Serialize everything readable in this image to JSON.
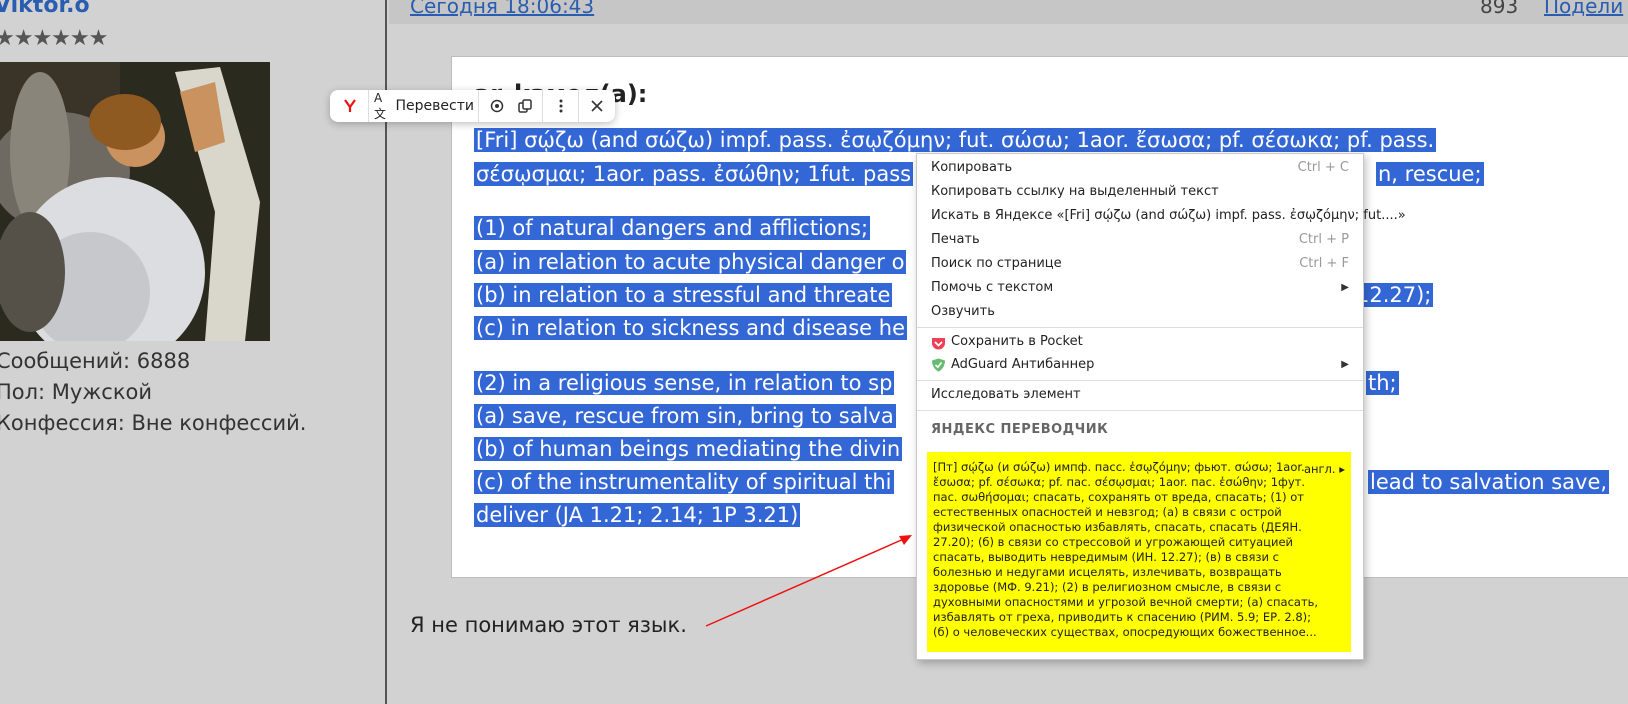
{
  "user": {
    "name": "Viktor.o",
    "stars": "★★★★★★",
    "messages": "Сообщений: 6888",
    "gender": "Пол: Мужской",
    "confession": "Конфессия: Вне конфессий."
  },
  "post": {
    "date": "Сегодня 18:06:43",
    "number": "893",
    "share": "Подели"
  },
  "quote": {
    "author": "ar_kaмeл(a):",
    "lines": [
      "[Fri] σῴζω (and σώζω) impf. pass. ἐσῳζόμην; fut. σώσω; 1aor. ἔσωσα; pf. σέσωκα; pf. pass.",
      "σέσῳσμαι; 1aor. pass. ἐσώθην; 1fut. pass",
      "(1) of natural dangers and afflictions;",
      "(a) in relation to acute physical danger o",
      "(b) in relation to a stressful and threate",
      "(c) in relation to sickness and disease he",
      "(2) in a religious sense, in relation to sp",
      "(a) save, rescue from sin, bring to salva",
      "(b) of human beings mediating the divin",
      "(c) of the instrumentality of spiritual thi",
      "deliver (JA 1.21; 2.14; 1P 3.21)"
    ],
    "right_fragments": [
      "n, rescue;",
      "12.27);",
      "th;",
      "lead to salvation save,"
    ]
  },
  "reply": "Я не понимаю этот язык.",
  "translate_bubble": {
    "translate_label": "Перевести"
  },
  "context_menu": {
    "items": [
      {
        "label": "Копировать",
        "shortcut": "Ctrl + C"
      },
      {
        "label": "Копировать ссылку на выделенный текст",
        "shortcut": ""
      },
      {
        "label": "Искать в Яндексе «[Fri] σῴζω (and σώζω) impf. pass. ἐσῳζόμην; fut....»",
        "shortcut": ""
      },
      {
        "label": "Печать",
        "shortcut": "Ctrl + P"
      },
      {
        "label": "Поиск по странице",
        "shortcut": "Ctrl + F"
      },
      {
        "label": "Помочь с текстом",
        "shortcut": ""
      },
      {
        "label": "Озвучить",
        "shortcut": ""
      },
      {
        "label": "Сохранить в Pocket",
        "shortcut": ""
      },
      {
        "label": "AdGuard Антибаннер",
        "shortcut": ""
      },
      {
        "label": "Исследовать элемент",
        "shortcut": ""
      }
    ],
    "translator_header": "ЯНДЕКС ПЕРЕВОДЧИК",
    "translator_lang": "англ.",
    "translation": "[Пт] σῴζω (и σώζω) импф. пасс. ἐσῳζόμην; фьют. σώσω; 1aor. ἔσωσα; pf. σέσωκα; pf. пас. σέσῳσμαι; 1aor. пас. ἐσώθην; 1фут. пас. σωθήσομαι; спасать, сохранять от вреда, спасать; (1) от естественных опасностей и невзгод; (а) в связи с острой физической опасностью избавлять, спасать, спасать (ДЕЯН. 27.20); (б) в связи со стрессовой и угрожающей ситуацией спасать, выводить невредимым (ИН. 12.27); (в) в связи с болезнью и недугами исцелять, излечивать, возвращать здоровье (МФ. 9.21); (2) в религиозном смысле, в связи с духовными опасностями и угрозой вечной смерти; (а) спасать, избавлять от греха, приводить к спасению (РИМ. 5.9; ЕР. 2.8); (б) о человеческих существах, опосредующих божественное..."
  },
  "colors": {
    "selection": "#3367d6",
    "link": "#2a5db0",
    "translation_bg": "#ffff00"
  }
}
